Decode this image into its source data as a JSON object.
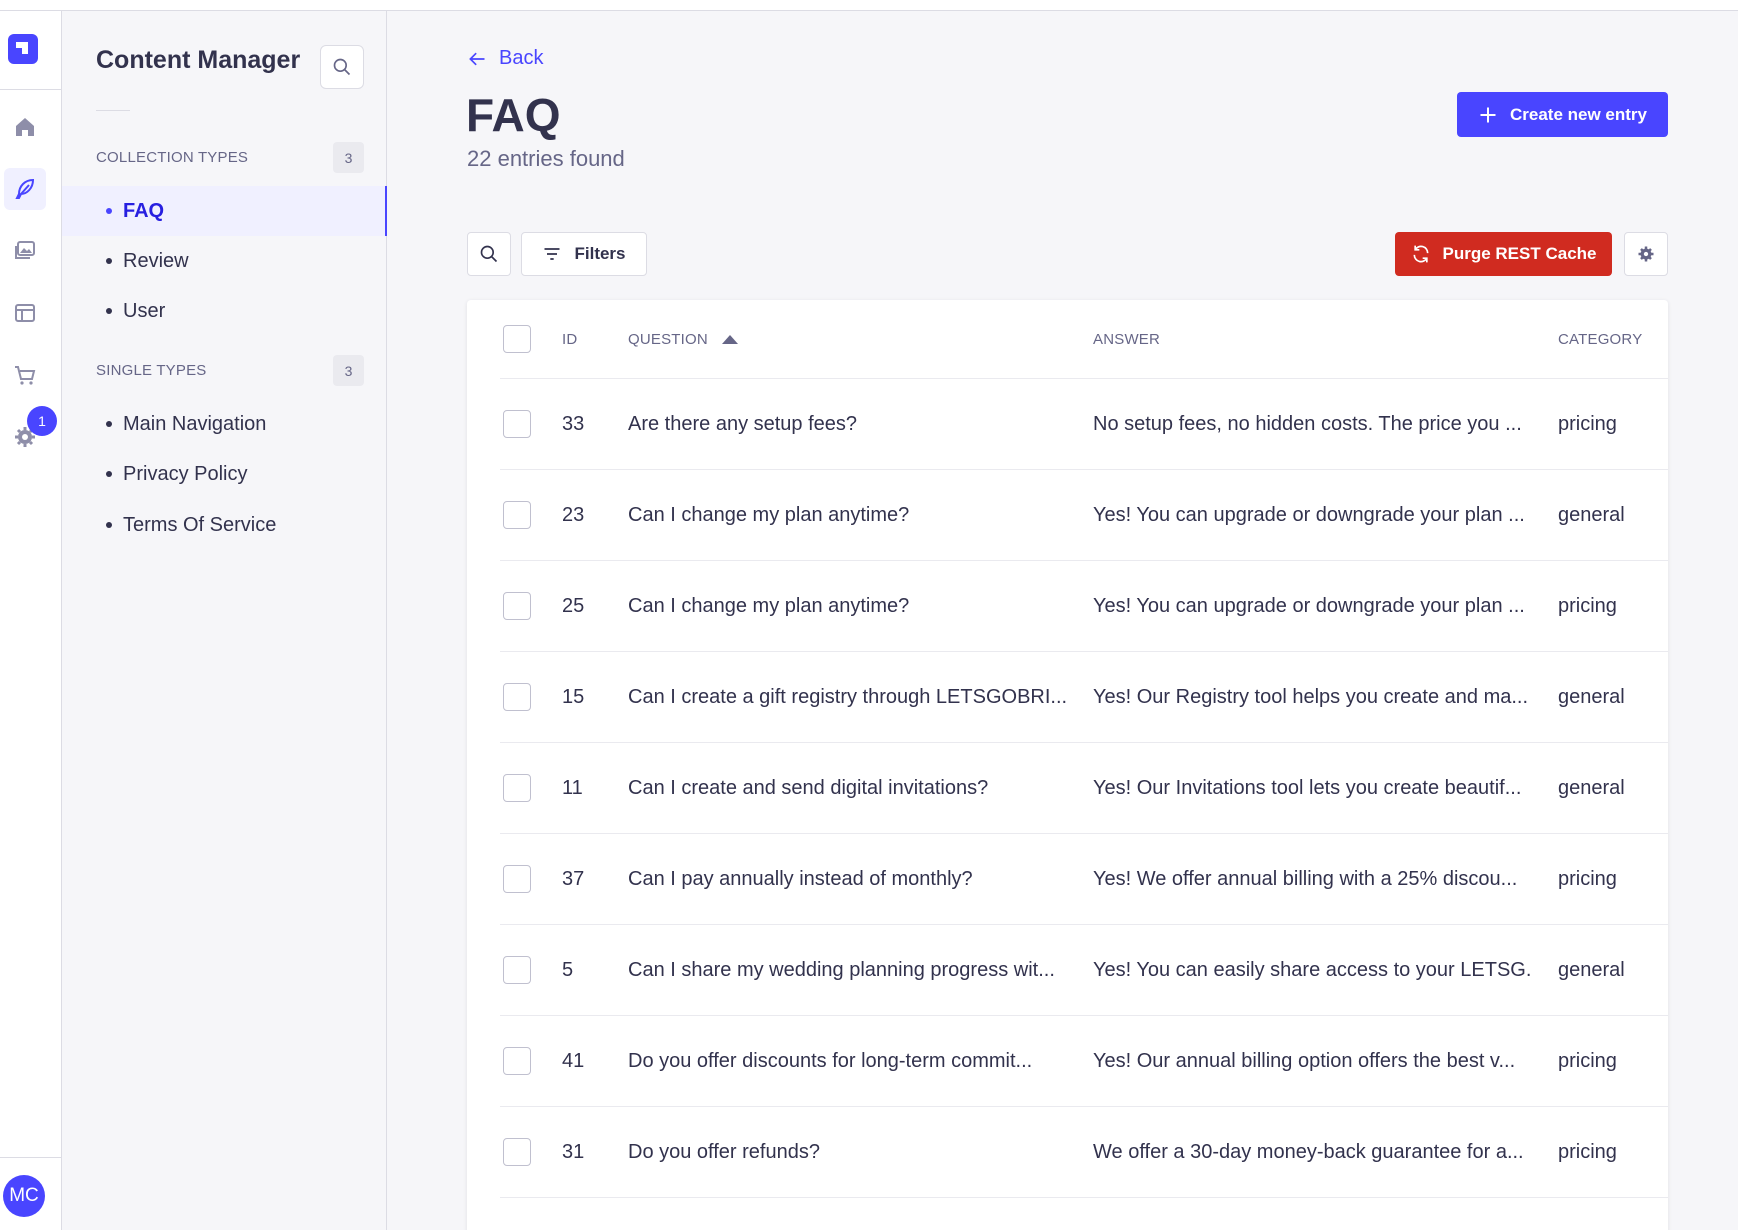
{
  "nav_rail": {
    "items": [
      {
        "icon": "home-icon"
      },
      {
        "icon": "feather-icon",
        "active": true
      },
      {
        "icon": "media-library-icon"
      },
      {
        "icon": "layout-icon"
      },
      {
        "icon": "cart-icon"
      },
      {
        "icon": "gear-icon"
      }
    ],
    "settings_badge": "1",
    "avatar_initials": "MC"
  },
  "sidebar": {
    "title": "Content Manager",
    "collection_types_label": "COLLECTION TYPES",
    "collection_types_count": "3",
    "collection_types": [
      {
        "label": "FAQ",
        "active": true
      },
      {
        "label": "Review"
      },
      {
        "label": "User"
      }
    ],
    "single_types_label": "SINGLE TYPES",
    "single_types_count": "3",
    "single_types": [
      {
        "label": "Main Navigation"
      },
      {
        "label": "Privacy Policy"
      },
      {
        "label": "Terms Of Service"
      }
    ]
  },
  "header": {
    "back_label": "Back",
    "title": "FAQ",
    "subtitle": "22 entries found",
    "create_label": "Create new entry"
  },
  "toolbar": {
    "filters_label": "Filters",
    "purge_label": "Purge REST Cache"
  },
  "table": {
    "columns": {
      "id": "ID",
      "question": "QUESTION",
      "answer": "ANSWER",
      "category": "CATEGORY"
    },
    "sort": {
      "column": "question",
      "direction": "ascending"
    },
    "rows": [
      {
        "id": "33",
        "question": "Are there any setup fees?",
        "answer": "No setup fees, no hidden costs. The price you ...",
        "category": "pricing"
      },
      {
        "id": "23",
        "question": "Can I change my plan anytime?",
        "answer": "Yes! You can upgrade or downgrade your plan ...",
        "category": "general"
      },
      {
        "id": "25",
        "question": "Can I change my plan anytime?",
        "answer": "Yes! You can upgrade or downgrade your plan ...",
        "category": "pricing"
      },
      {
        "id": "15",
        "question": "Can I create a gift registry through LETSGOBRI...",
        "answer": "Yes! Our Registry tool helps you create and ma...",
        "category": "general"
      },
      {
        "id": "11",
        "question": "Can I create and send digital invitations?",
        "answer": "Yes! Our Invitations tool lets you create beautif...",
        "category": "general"
      },
      {
        "id": "37",
        "question": "Can I pay annually instead of monthly?",
        "answer": "Yes! We offer annual billing with a 25% discou...",
        "category": "pricing"
      },
      {
        "id": "5",
        "question": "Can I share my wedding planning progress wit...",
        "answer": "Yes! You can easily share access to your LETSG...",
        "category": "general"
      },
      {
        "id": "41",
        "question": "Do you offer discounts for long-term commit...",
        "answer": "Yes! Our annual billing option offers the best v...",
        "category": "pricing"
      },
      {
        "id": "31",
        "question": "Do you offer refunds?",
        "answer": "We offer a 30-day money-back guarantee for a...",
        "category": "pricing"
      }
    ]
  },
  "colors": {
    "primary": "#4945ff",
    "danger": "#d02b20",
    "background": "#f6f6f9",
    "text": "#32324d",
    "muted": "#666687"
  }
}
